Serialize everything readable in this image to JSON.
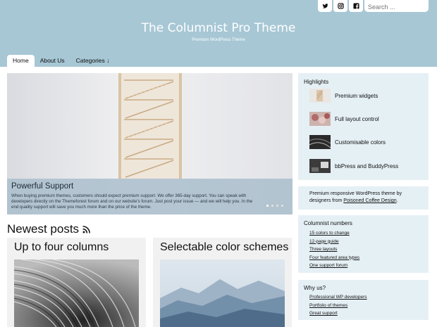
{
  "header": {
    "title": "The Columnist Pro Theme",
    "tagline": "Premium WordPress Theme",
    "search_placeholder": "Search ...",
    "social": [
      {
        "icon": "twitter-icon"
      },
      {
        "icon": "instagram-icon"
      },
      {
        "icon": "facebook-icon"
      }
    ],
    "colors": {
      "header_bg": "#a7c7d5",
      "sidebar_bg": "#e5f0f5"
    }
  },
  "nav": {
    "home": "Home",
    "about": "About Us",
    "categories": "Categories ↓"
  },
  "slider": {
    "title": "Powerful Support",
    "text": "When buying premium themes, customers should expect premium support. We offer 365-day support. You can speak with developers directly on the Themeforest forum and on our website's forum. Just post your issue — and we will help you. In the end quality support will save you much more than the price of the theme.",
    "slides": 4,
    "active_slide": 1
  },
  "main": {
    "section_title": "Newest posts",
    "posts": [
      {
        "title": "Up to four columns"
      },
      {
        "title": "Selectable color schemes"
      }
    ]
  },
  "sidebar": {
    "highlights": {
      "title": "Highlights",
      "items": [
        {
          "label": "Premium widgets"
        },
        {
          "label": "Full layout control"
        },
        {
          "label": "Customisable colors"
        },
        {
          "label": "bbPress and BuddyPress"
        }
      ]
    },
    "about": {
      "text": "Premium responsive WordPress theme by designers from ",
      "link": "Poisoned Coffee Design",
      "end": "."
    },
    "numbers": {
      "title": "Columnist numbers",
      "links": [
        "15 colors to change",
        "12-page guide",
        "Three layouts",
        "Four featured area types",
        "One support forum"
      ]
    },
    "why": {
      "title": "Why us?",
      "links": [
        "Professional WP developers",
        "Portfolio of themes",
        "Great support"
      ]
    }
  }
}
